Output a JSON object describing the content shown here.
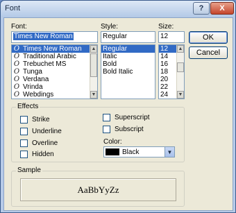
{
  "window": {
    "title": "Font",
    "help_label": "?",
    "close_label": "X"
  },
  "font": {
    "label": "Font:",
    "value": "Times New Roman",
    "items": [
      "Times New Roman",
      "Traditional Arabic",
      "Trebuchet MS",
      "Tunga",
      "Verdana",
      "Vrinda",
      "Webdings"
    ],
    "selected_index": 0
  },
  "style": {
    "label": "Style:",
    "value": "Regular",
    "items": [
      "Regular",
      "Italic",
      "Bold",
      "Bold Italic"
    ],
    "selected_index": 0
  },
  "size": {
    "label": "Size:",
    "value": "12",
    "items": [
      "12",
      "14",
      "16",
      "18",
      "20",
      "22",
      "24"
    ],
    "selected_index": 0
  },
  "buttons": {
    "ok": "OK",
    "cancel": "Cancel"
  },
  "effects": {
    "title": "Effects",
    "strike": "Strike",
    "underline": "Underline",
    "overline": "Overline",
    "hidden": "Hidden",
    "superscript": "Superscript",
    "subscript": "Subscript",
    "color_label": "Color:",
    "color_value": "Black",
    "color_hex": "#000000"
  },
  "sample": {
    "title": "Sample",
    "text": "AaBbYyZz"
  }
}
